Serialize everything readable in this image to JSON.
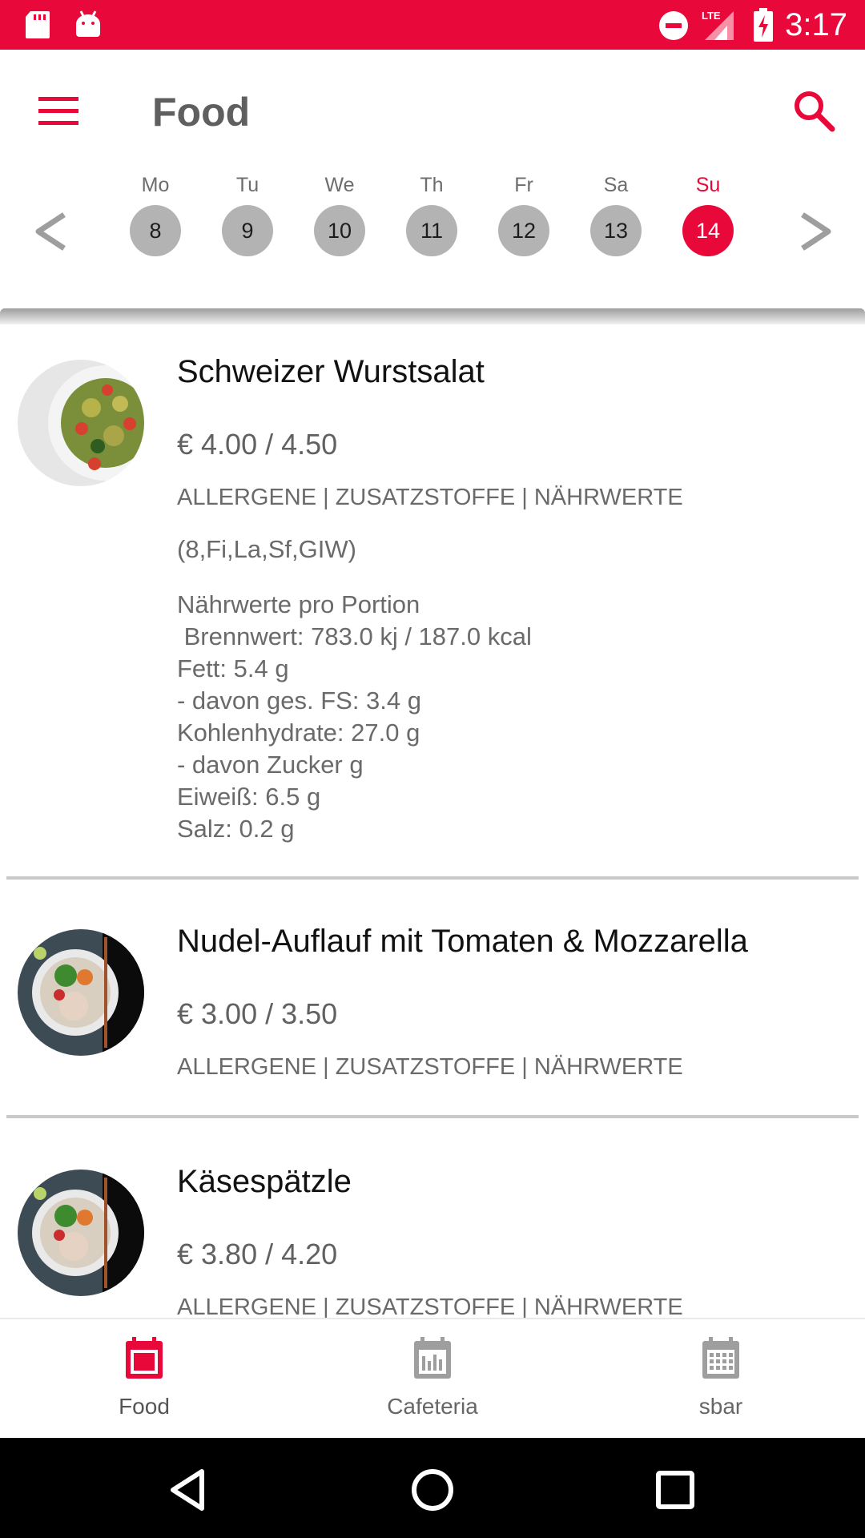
{
  "status_bar": {
    "time": "3:17",
    "network": "LTE",
    "icons": [
      "sd-card-icon",
      "android-icon",
      "do-not-disturb-icon",
      "signal-icon",
      "battery-charging-icon"
    ]
  },
  "app_bar": {
    "title": "Food",
    "menu_icon": "menu-icon",
    "search_icon": "search-icon"
  },
  "week": {
    "prev_icon": "chevron-left-icon",
    "next_icon": "chevron-right-icon",
    "days": [
      {
        "name": "Mo",
        "num": "8"
      },
      {
        "name": "Tu",
        "num": "9"
      },
      {
        "name": "We",
        "num": "10"
      },
      {
        "name": "Th",
        "num": "11"
      },
      {
        "name": "Fr",
        "num": "12"
      },
      {
        "name": "Sa",
        "num": "13"
      },
      {
        "name": "Su",
        "num": "14"
      }
    ],
    "selected_index": 6
  },
  "meals": [
    {
      "name": "Schweizer Wurstsalat",
      "price": "€ 4.00 / 4.50",
      "links": "ALLERGENE | ZUSATZSTOFFE | NÄHRWERTE",
      "allergens": "(8,Fi,La,Sf,GIW)",
      "nutrition": "Nährwerte pro Portion\n Brennwert: 783.0 kj / 187.0 kcal\nFett: 5.4 g\n- davon ges. FS: 3.4 g\nKohlenhydrate: 27.0 g\n- davon Zucker g\nEiweiß: 6.5 g\nSalz: 0.2 g"
    },
    {
      "name": "Nudel-Auflauf mit Tomaten & Mozzarella",
      "price": "€ 3.00 / 3.50",
      "links": "ALLERGENE | ZUSATZSTOFFE | NÄHRWERTE"
    },
    {
      "name": "Käsespätzle",
      "price": "€ 3.80 / 4.20",
      "links": "ALLERGENE | ZUSATZSTOFFE | NÄHRWERTE"
    }
  ],
  "bottom_nav": {
    "items": [
      {
        "label": "Food",
        "icon": "calendar-today-icon"
      },
      {
        "label": "Cafeteria",
        "icon": "calendar-chart-icon"
      },
      {
        "label": "sbar",
        "icon": "calendar-grid-icon"
      }
    ],
    "active_index": 0
  },
  "colors": {
    "accent": "#e8093a",
    "inactive_day": "#b3b3b3",
    "text_secondary": "#6a6a6a",
    "nav_inactive_icon": "#9e9e9e"
  }
}
